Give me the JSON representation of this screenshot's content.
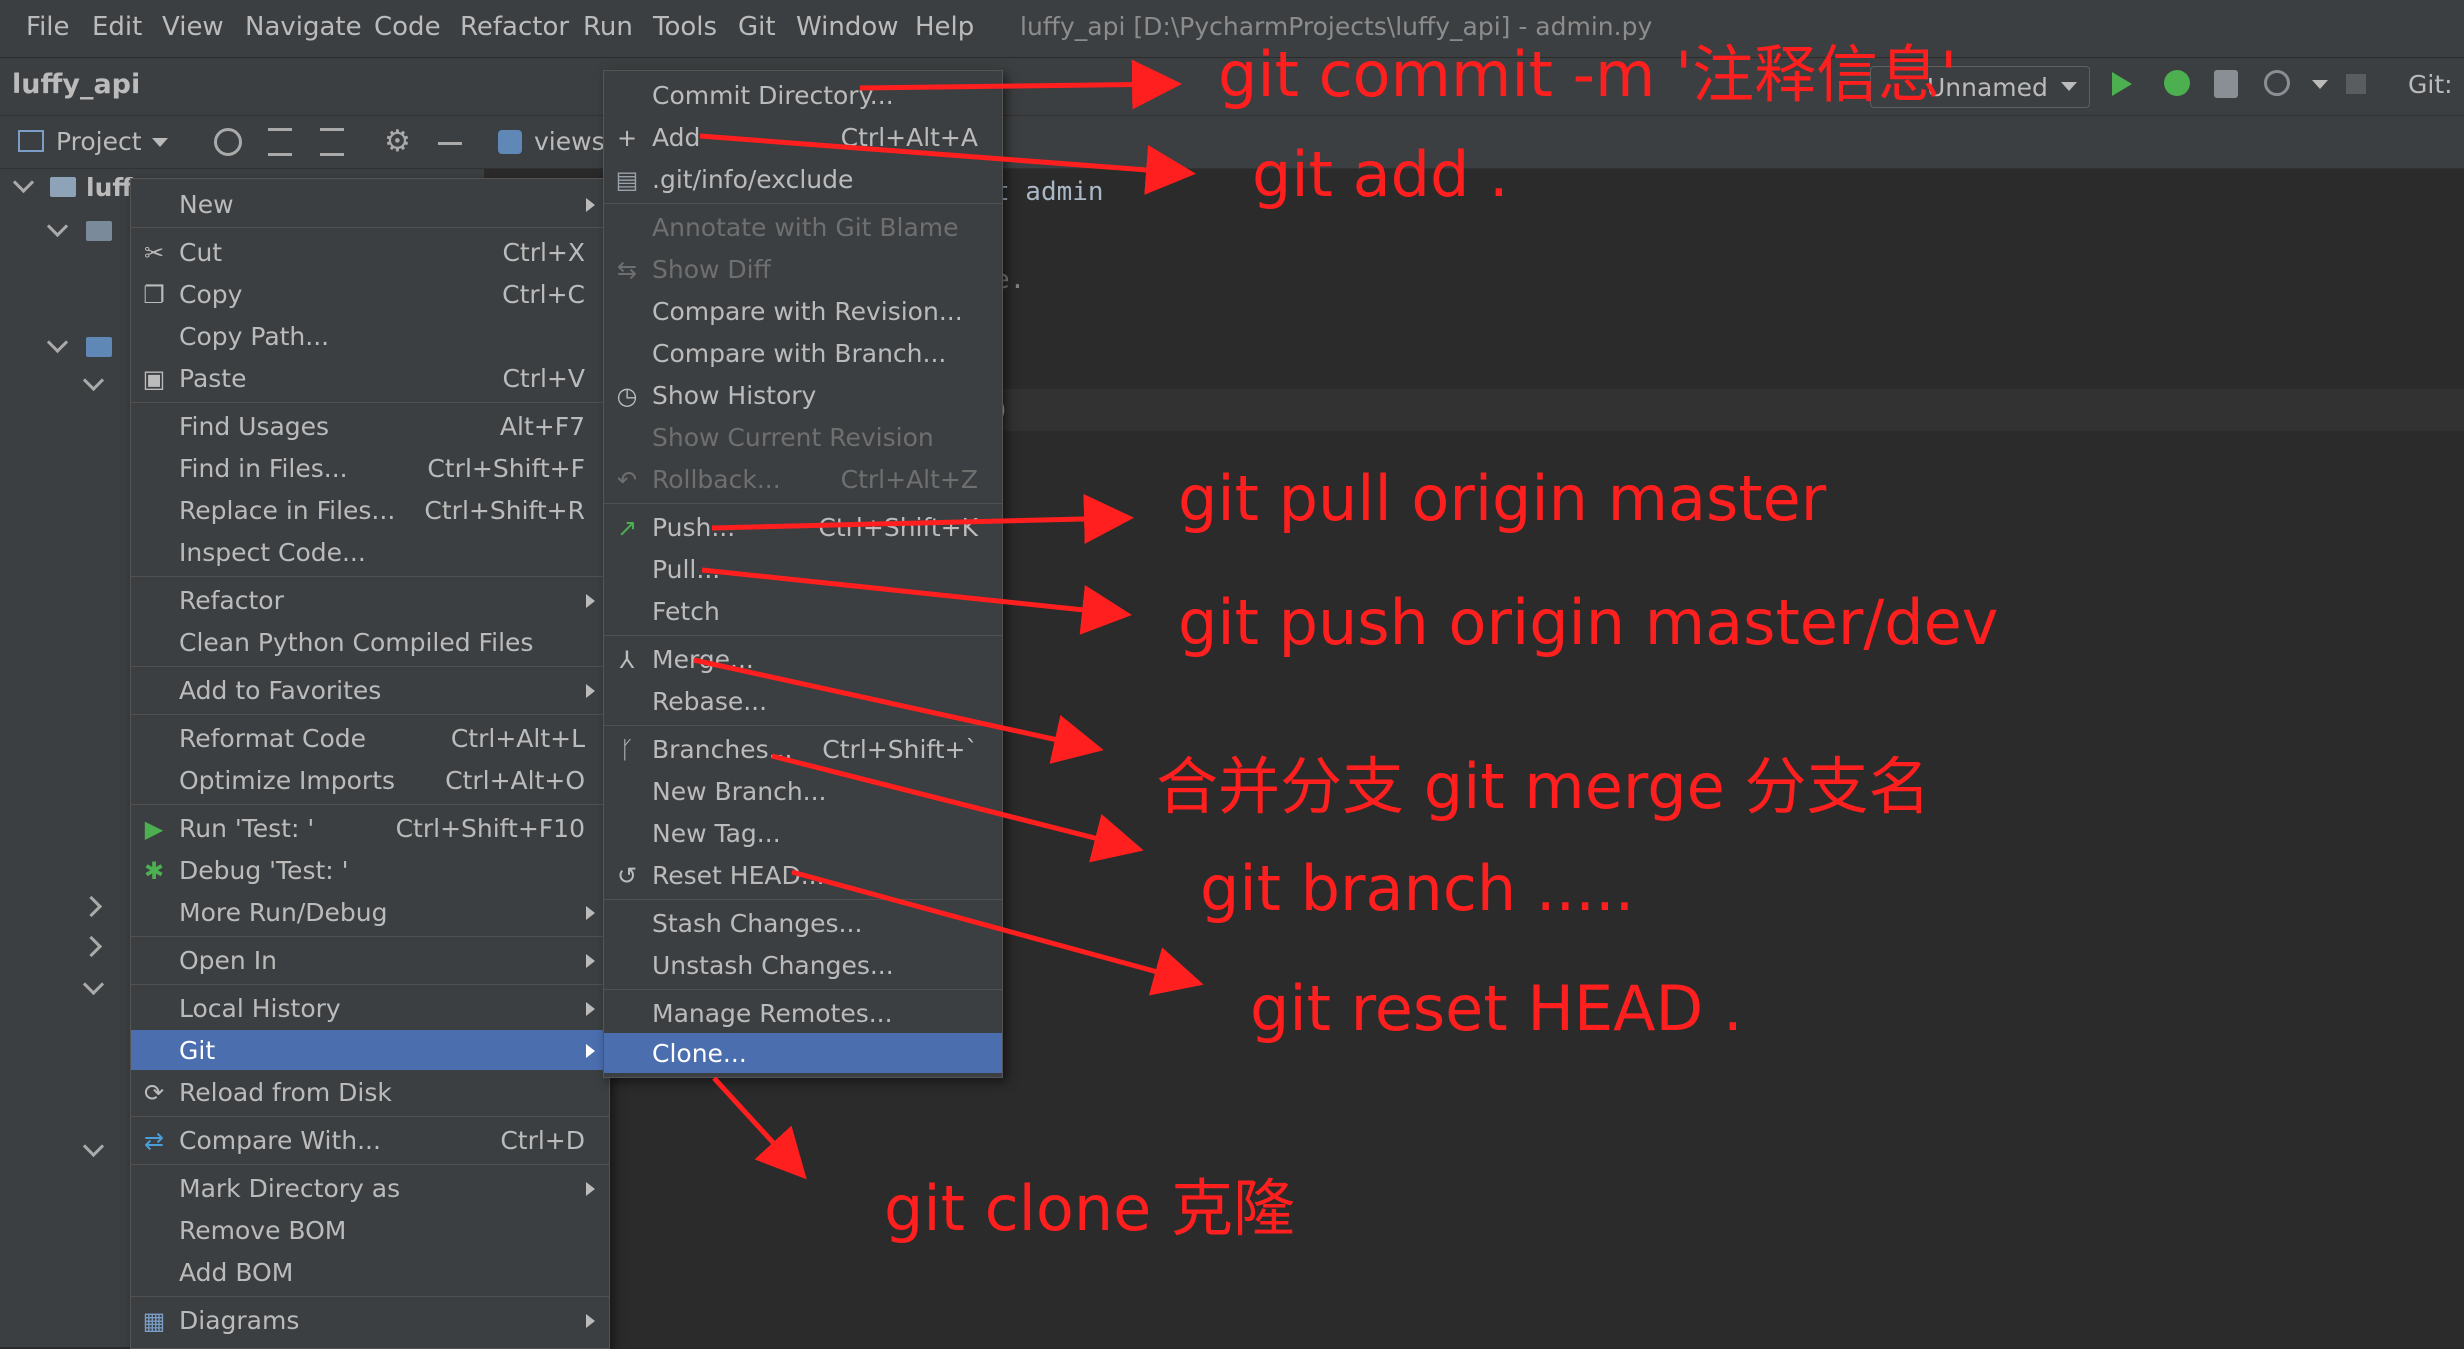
{
  "menubar": {
    "items": [
      "File",
      "Edit",
      "View",
      "Navigate",
      "Code",
      "Refactor",
      "Run",
      "Tools",
      "Git",
      "Window",
      "Help"
    ],
    "window_title": "luffy_api [D:\\PycharmProjects\\luffy_api] - admin.py"
  },
  "navbar": {
    "project_name": "luffy_api",
    "run_config": "Unnamed",
    "git_label": "Git:"
  },
  "project_panel": {
    "title": "Project",
    "root_label": "luff",
    "tab_label": "views."
  },
  "editor": {
    "lines": [
      {
        "text": "t admin",
        "dim": false
      },
      {
        "text": "e.",
        "dim": true
      },
      {
        "text": "'",
        "dim": true
      },
      {
        "text": ")",
        "dim": false
      }
    ]
  },
  "context_menu": {
    "items": [
      {
        "label": "New",
        "shortcut": "",
        "submenu": true
      },
      {
        "label": "Cut",
        "shortcut": "Ctrl+X",
        "icon": "scissors-icon"
      },
      {
        "label": "Copy",
        "shortcut": "Ctrl+C",
        "icon": "copy-icon"
      },
      {
        "label": "Copy Path...",
        "shortcut": ""
      },
      {
        "label": "Paste",
        "shortcut": "Ctrl+V",
        "icon": "clipboard-icon"
      },
      {
        "label": "Find Usages",
        "shortcut": "Alt+F7"
      },
      {
        "label": "Find in Files...",
        "shortcut": "Ctrl+Shift+F"
      },
      {
        "label": "Replace in Files...",
        "shortcut": "Ctrl+Shift+R"
      },
      {
        "label": "Inspect Code...",
        "shortcut": ""
      },
      {
        "label": "Refactor",
        "shortcut": "",
        "submenu": true
      },
      {
        "label": "Clean Python Compiled Files",
        "shortcut": ""
      },
      {
        "label": "Add to Favorites",
        "shortcut": "",
        "submenu": true
      },
      {
        "label": "Reformat Code",
        "shortcut": "Ctrl+Alt+L"
      },
      {
        "label": "Optimize Imports",
        "shortcut": "Ctrl+Alt+O"
      },
      {
        "label": "Run 'Test: '",
        "shortcut": "Ctrl+Shift+F10",
        "icon": "run-icon"
      },
      {
        "label": "Debug 'Test: '",
        "shortcut": "",
        "icon": "debug-icon"
      },
      {
        "label": "More Run/Debug",
        "shortcut": "",
        "submenu": true
      },
      {
        "label": "Open In",
        "shortcut": "",
        "submenu": true
      },
      {
        "label": "Local History",
        "shortcut": "",
        "submenu": true
      },
      {
        "label": "Git",
        "shortcut": "",
        "submenu": true,
        "selected": true
      },
      {
        "label": "Reload from Disk",
        "shortcut": "",
        "icon": "reload-icon"
      },
      {
        "label": "Compare With...",
        "shortcut": "Ctrl+D",
        "icon": "compare-icon"
      },
      {
        "label": "Mark Directory as",
        "shortcut": "",
        "submenu": true
      },
      {
        "label": "Remove BOM",
        "shortcut": ""
      },
      {
        "label": "Add BOM",
        "shortcut": ""
      },
      {
        "label": "Diagrams",
        "shortcut": "",
        "submenu": true,
        "icon": "diagram-icon"
      }
    ]
  },
  "git_submenu": {
    "items": [
      {
        "label": "Commit Directory...",
        "shortcut": ""
      },
      {
        "label": "Add",
        "shortcut": "Ctrl+Alt+A",
        "icon": "plus-icon"
      },
      {
        "label": ".git/info/exclude",
        "shortcut": "",
        "icon": "file-icon"
      },
      {
        "label": "Annotate with Git Blame",
        "shortcut": "",
        "disabled": true
      },
      {
        "label": "Show Diff",
        "shortcut": "",
        "disabled": true,
        "icon": "diff-icon"
      },
      {
        "label": "Compare with Revision...",
        "shortcut": ""
      },
      {
        "label": "Compare with Branch...",
        "shortcut": ""
      },
      {
        "label": "Show History",
        "shortcut": "",
        "icon": "clock-icon"
      },
      {
        "label": "Show Current Revision",
        "shortcut": "",
        "disabled": true
      },
      {
        "label": "Rollback...",
        "shortcut": "Ctrl+Alt+Z",
        "disabled": true,
        "icon": "rollback-icon"
      },
      {
        "label": "Push...",
        "shortcut": "Ctrl+Shift+K",
        "icon": "push-icon"
      },
      {
        "label": "Pull...",
        "shortcut": ""
      },
      {
        "label": "Fetch",
        "shortcut": ""
      },
      {
        "label": "Merge...",
        "shortcut": "",
        "icon": "merge-icon"
      },
      {
        "label": "Rebase...",
        "shortcut": ""
      },
      {
        "label": "Branches...",
        "shortcut": "Ctrl+Shift+`",
        "icon": "branch-icon"
      },
      {
        "label": "New Branch...",
        "shortcut": ""
      },
      {
        "label": "New Tag...",
        "shortcut": ""
      },
      {
        "label": "Reset HEAD...",
        "shortcut": "",
        "icon": "reset-icon"
      },
      {
        "label": "Stash Changes...",
        "shortcut": ""
      },
      {
        "label": "Unstash Changes...",
        "shortcut": ""
      },
      {
        "label": "Manage Remotes...",
        "shortcut": ""
      },
      {
        "label": "Clone...",
        "shortcut": "",
        "selected": true
      }
    ]
  },
  "annotations": [
    "git commit -m '注释信息'",
    "git add .",
    "git pull origin master",
    "git push origin master/dev",
    "合并分支 git merge 分支名",
    "git branch .....",
    "git reset HEAD  .",
    "git clone 克隆"
  ],
  "colors": {
    "annotation": "#ff1f1f",
    "selection": "#4b6eaf",
    "menu_bg": "#3c3f41",
    "editor_bg": "#2b2b2b"
  }
}
